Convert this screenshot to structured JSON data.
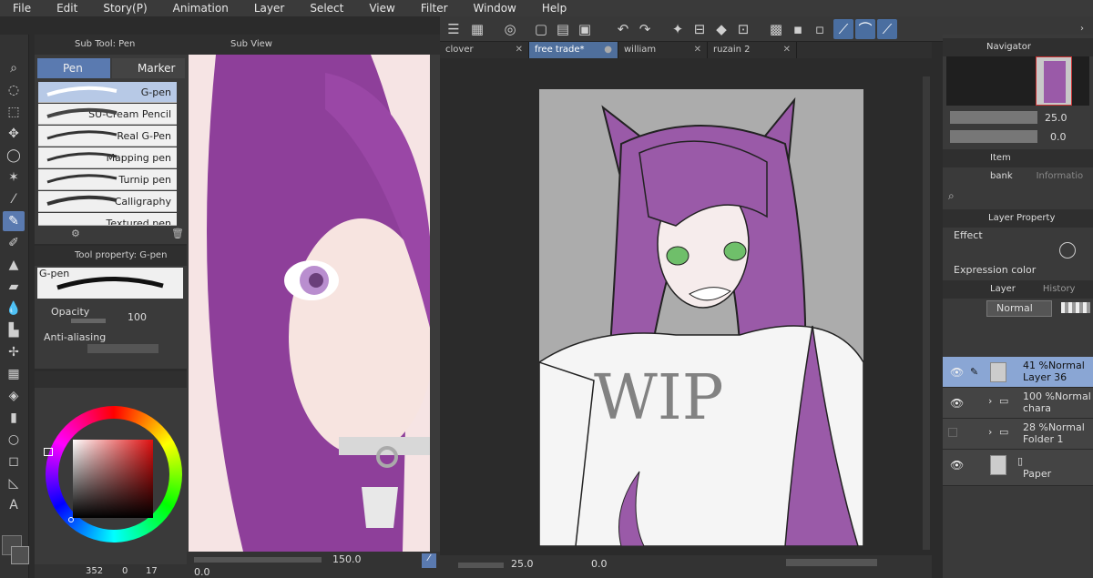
{
  "menu": [
    "File",
    "Edit",
    "Story(P)",
    "Animation",
    "Layer",
    "Select",
    "View",
    "Filter",
    "Window",
    "Help"
  ],
  "subtool": {
    "title": "Sub Tool: Pen",
    "tabs": [
      "Pen",
      "Marker"
    ],
    "brushes": [
      "G-pen",
      "SU-Cream Pencil",
      "Real G-Pen",
      "Mapping pen",
      "Turnip pen",
      "Calligraphy",
      "Textured pen"
    ]
  },
  "toolprop": {
    "title": "Tool property: G-pen",
    "brush_name": "G-pen",
    "opacity_label": "Opacity",
    "opacity_value": "100",
    "antialias_label": "Anti-aliasing"
  },
  "subview": {
    "title": "Sub View",
    "zoom": "150.0",
    "angle": "0.0"
  },
  "tabs": [
    "clover",
    "free trade*",
    "william",
    "ruzain 2"
  ],
  "canvas": {
    "watermark": "WIP",
    "zoom": "25.0",
    "angle": "0.0"
  },
  "status": {
    "left_value": "352",
    "s_value": "0",
    "v_value": "17"
  },
  "navigator": {
    "title": "Navigator",
    "zoom": "25.0",
    "angle": "0.0"
  },
  "itembank": {
    "title": "Item bank",
    "info_title": "Informatio"
  },
  "layerprop": {
    "title": "Layer Property",
    "tab2": "History",
    "effect_label": "Effect",
    "expression_label": "Expression color"
  },
  "layers": {
    "tab1": "Layer",
    "tab2": "History",
    "blend_mode": "Normal",
    "rows": [
      {
        "line1": "41 %Normal",
        "line2": "Layer 36"
      },
      {
        "line1": "100 %Normal",
        "line2": "chara"
      },
      {
        "line1": "28 %Normal",
        "line2": "Folder 1"
      },
      {
        "line1": "",
        "line2": "Paper"
      }
    ]
  },
  "colors": {
    "accent": "#5a7ab0",
    "hair": "#9a5aa8",
    "canvasbg": "#a9a9a9"
  }
}
